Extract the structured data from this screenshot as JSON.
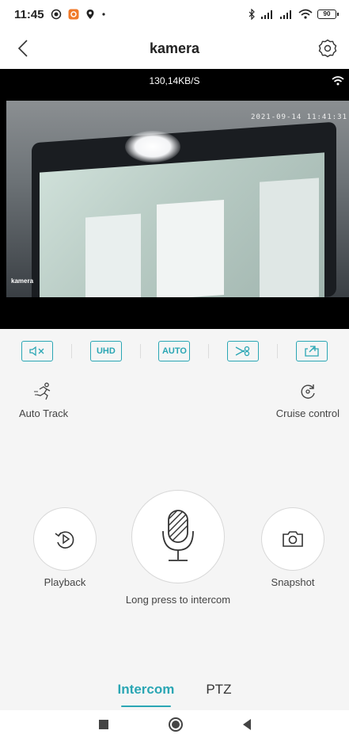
{
  "status_bar": {
    "time": "11:45",
    "battery": "90"
  },
  "header": {
    "title": "kamera"
  },
  "video": {
    "speed": "130,14KB/S",
    "timestamp": "2021-09-14 11:41:31",
    "camera_label": "kamera"
  },
  "toolbar": {
    "uhd_label": "UHD",
    "auto_label": "AUTO"
  },
  "features": {
    "auto_track": "Auto Track",
    "cruise_control": "Cruise control"
  },
  "controls": {
    "playback": "Playback",
    "intercom_hint": "Long press to intercom",
    "snapshot": "Snapshot"
  },
  "tabs": [
    {
      "label": "Intercom",
      "active": true
    },
    {
      "label": "PTZ",
      "active": false
    }
  ],
  "colors": {
    "accent": "#2aa6b4"
  }
}
